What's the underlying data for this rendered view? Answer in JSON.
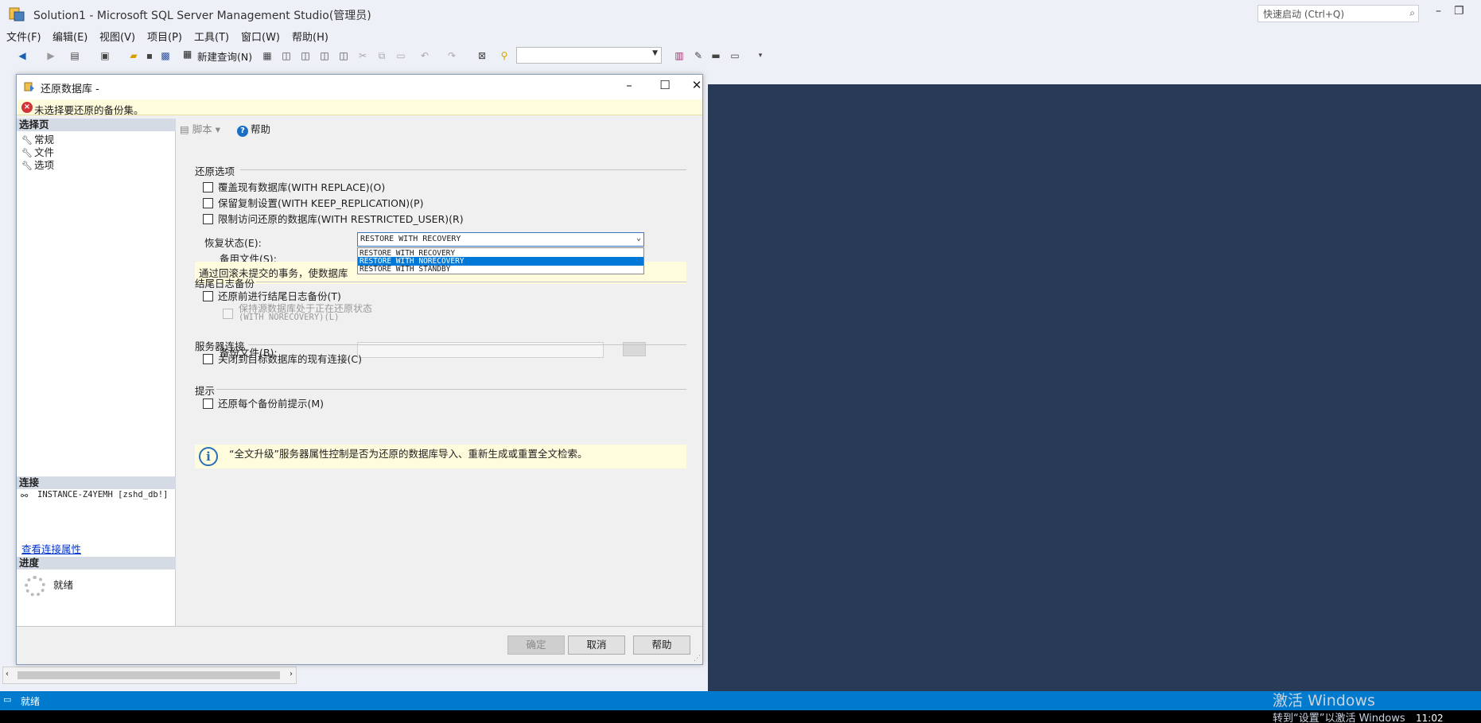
{
  "app": {
    "title": "Solution1 - Microsoft SQL Server Management Studio(管理员)",
    "quick_launch_placeholder": "快速启动 (Ctrl+Q)"
  },
  "menu": [
    "文件(F)",
    "编辑(E)",
    "视图(V)",
    "项目(P)",
    "工具(T)",
    "窗口(W)",
    "帮助(H)"
  ],
  "toolbar": {
    "new_query_label": "新建查询(N)",
    "combo_value": ""
  },
  "dialog": {
    "title": "还原数据库 -",
    "error_message": "未选择要还原的备份集。",
    "left": {
      "select_page_header": "选择页",
      "pages": [
        "常规",
        "文件",
        "选项"
      ],
      "connection_header": "连接",
      "connection_text": "INSTANCE-Z4YEMH [zshd_db!]",
      "connection_props_link": "查看连接属性",
      "progress_header": "进度",
      "progress_status": "就绪"
    },
    "right": {
      "script_label": "脚本",
      "help_label": "帮助",
      "restore_options": {
        "title": "还原选项",
        "overwrite_label": "覆盖现有数据库(WITH REPLACE)(O)",
        "keep_replication_label": "保留复制设置(WITH KEEP_REPLICATION)(P)",
        "restricted_user_label": "限制访问还原的数据库(WITH RESTRICTED_USER)(R)",
        "recovery_state_label": "恢复状态(E):",
        "recovery_state_value": "RESTORE WITH RECOVERY",
        "recovery_options": [
          "RESTORE WITH RECOVERY",
          "RESTORE WITH NORECOVERY",
          "RESTORE WITH STANDBY"
        ],
        "recovery_selected_index": 1,
        "standby_file_label": "备用文件(S):",
        "hint": "通过回滚未提交的事务，使数据库"
      },
      "tail_log": {
        "title": "结尾日志备份",
        "take_tail_log_label": "还原前进行结尾日志备份(T)",
        "leave_source_label_1": "保持源数据库处于正在还原状态",
        "leave_source_label_2": "(WITH NORECOVERY)(L)",
        "backup_file_label": "备份文件(B):"
      },
      "server_connection": {
        "title": "服务器连接",
        "close_connections_label": "关闭到目标数据库的现有连接(C)"
      },
      "prompt": {
        "title": "提示",
        "prompt_before_label": "还原每个备份前提示(M)",
        "info_text": "“全文升级”服务器属性控制是否为还原的数据库导入、重新生成或重置全文检索。"
      }
    },
    "buttons": {
      "ok": "确定",
      "cancel": "取消",
      "help": "帮助"
    }
  },
  "status_bar": {
    "text": "就绪"
  },
  "watermark": {
    "title": "激活 Windows",
    "subtitle": "转到“设置”以激活 Windows"
  },
  "clock": "11:02"
}
